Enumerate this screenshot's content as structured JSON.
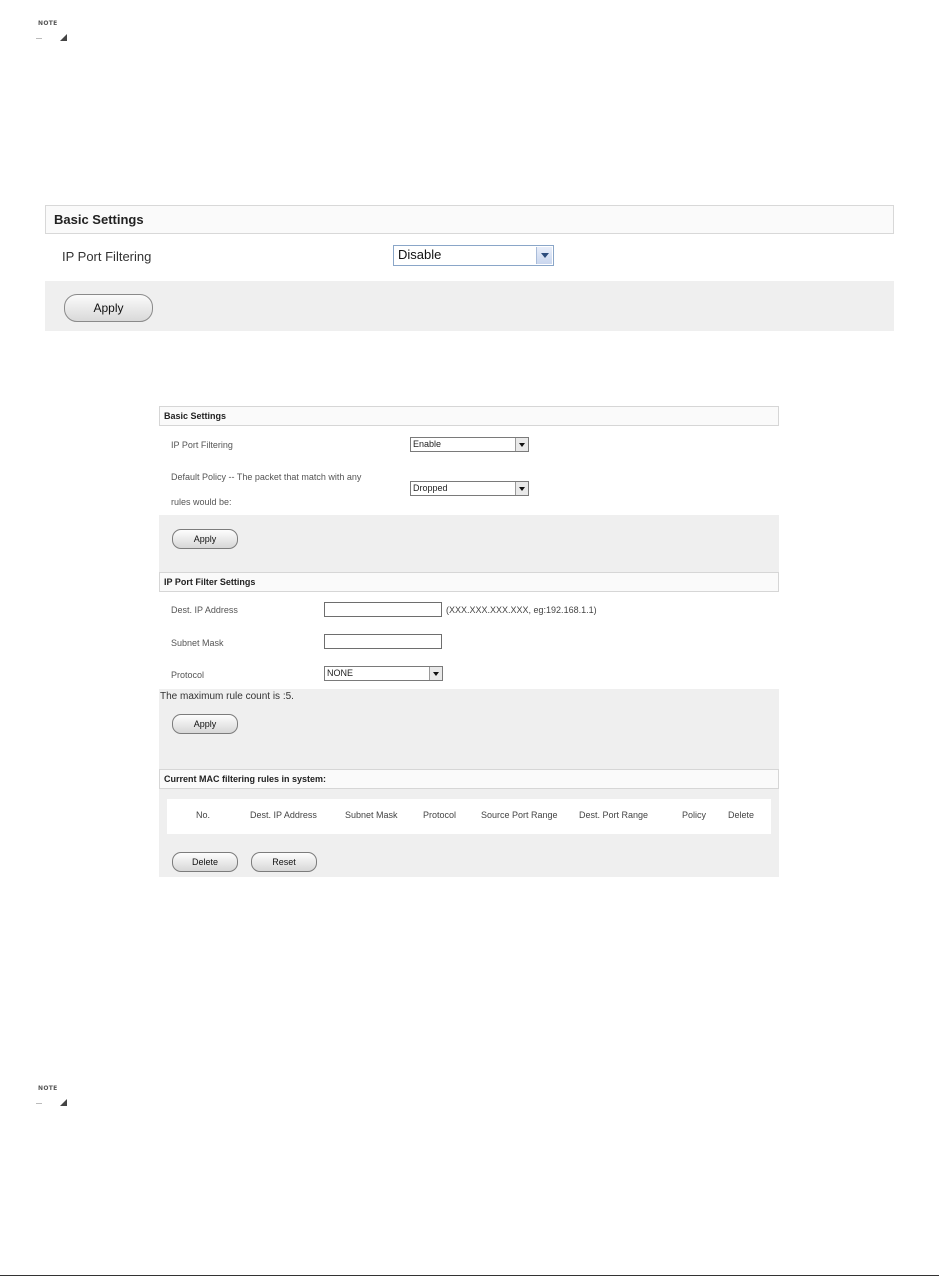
{
  "note_icons": [
    {
      "label": "NOTE"
    },
    {
      "label": "NOTE"
    }
  ],
  "panel_large": {
    "header": "Basic Settings",
    "ip_port_filtering_label": "IP Port Filtering",
    "ip_port_filtering_value": "Disable",
    "apply_label": "Apply"
  },
  "panel_small": {
    "basic": {
      "header": "Basic Settings",
      "ip_port_filtering_label": "IP Port Filtering",
      "ip_port_filtering_value": "Enable",
      "default_policy_label_1": "Default Policy -- The packet that match with any",
      "default_policy_label_2": "rules would be:",
      "default_policy_value": "Dropped",
      "apply_label": "Apply"
    },
    "filter": {
      "header": "IP Port Filter Settings",
      "dest_ip_label": "Dest. IP Address",
      "dest_ip_value": "",
      "dest_ip_hint": "(XXX.XXX.XXX.XXX, eg:192.168.1.1)",
      "subnet_label": "Subnet Mask",
      "subnet_value": "",
      "protocol_label": "Protocol",
      "protocol_value": "NONE",
      "max_rule_text": "The maximum rule count is :5.",
      "apply_label": "Apply"
    },
    "rules": {
      "header": "Current MAC filtering rules in system:",
      "columns": [
        "No.",
        "Dest. IP Address",
        "Subnet Mask",
        "Protocol",
        "Source Port Range",
        "Dest. Port Range",
        "Policy",
        "Delete"
      ],
      "delete_label": "Delete",
      "reset_label": "Reset"
    }
  }
}
